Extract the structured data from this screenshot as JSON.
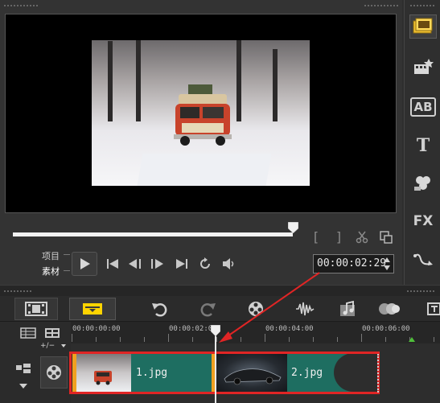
{
  "preview": {
    "mode_project": "项目",
    "mode_clip": "素材",
    "timecode": "00:00:02:29",
    "scrub_progress": 0.95
  },
  "right_toolbar": {
    "items": [
      {
        "name": "media-library-icon"
      },
      {
        "name": "instant-project-icon"
      },
      {
        "name": "title-icon",
        "glyph": "AB"
      },
      {
        "name": "text-icon",
        "glyph": "T"
      },
      {
        "name": "graphics-icon"
      },
      {
        "name": "filter-icon",
        "glyph": "FX"
      },
      {
        "name": "path-icon"
      }
    ]
  },
  "timeline": {
    "zoom_label": "+/−",
    "ruler_labels": [
      "00:00:00:00",
      "00:00:02:00",
      "00:00:04:00",
      "00:00:06:00"
    ],
    "clips": [
      {
        "label": "1.jpg"
      },
      {
        "label": "2.jpg"
      }
    ]
  },
  "colors": {
    "accent_yellow": "#ffd400",
    "clip_green": "#1e6e61",
    "selection_red": "#e02525"
  }
}
